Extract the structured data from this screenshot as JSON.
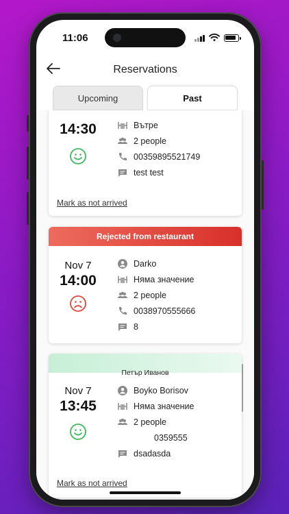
{
  "status_bar": {
    "time": "11:06"
  },
  "header": {
    "title": "Reservations"
  },
  "tabs": [
    {
      "label": "Upcoming",
      "active": false
    },
    {
      "label": "Past",
      "active": true
    }
  ],
  "cards": [
    {
      "time": "14:30",
      "face": "happy",
      "rows": [
        {
          "icon": "table-icon",
          "text": "Вътре"
        },
        {
          "icon": "people-icon",
          "text": "2 people"
        },
        {
          "icon": "phone-icon",
          "text": "00359895521749"
        },
        {
          "icon": "comment-icon",
          "text": "test test"
        }
      ],
      "action": "Mark as not arrived"
    },
    {
      "banner": "Rejected from restaurant",
      "date": "Nov 7",
      "time": "14:00",
      "face": "sad",
      "rows": [
        {
          "icon": "user-icon",
          "text": "Darko"
        },
        {
          "icon": "table-icon",
          "text": "Няма значение"
        },
        {
          "icon": "people-icon",
          "text": "2 people"
        },
        {
          "icon": "phone-icon",
          "text": "0038970555666"
        },
        {
          "icon": "comment-icon",
          "text": "8"
        }
      ]
    },
    {
      "banner": "Петър Иванов",
      "date": "Nov 7",
      "time": "13:45",
      "face": "happy",
      "rows": [
        {
          "icon": "user-icon",
          "text": "Boyko Borisov"
        },
        {
          "icon": "table-icon",
          "text": "Няма значение"
        },
        {
          "icon": "people-icon",
          "text": "2 people"
        },
        {
          "icon": "phone-icon",
          "text": "0359555"
        },
        {
          "icon": "comment-icon",
          "text": "dsadasda"
        }
      ],
      "action": "Mark as not arrived"
    }
  ],
  "colors": {
    "happy": "#3cb95a",
    "sad": "#e0453a",
    "rejected": "#d8302a",
    "icon": "#8a8a8a"
  }
}
